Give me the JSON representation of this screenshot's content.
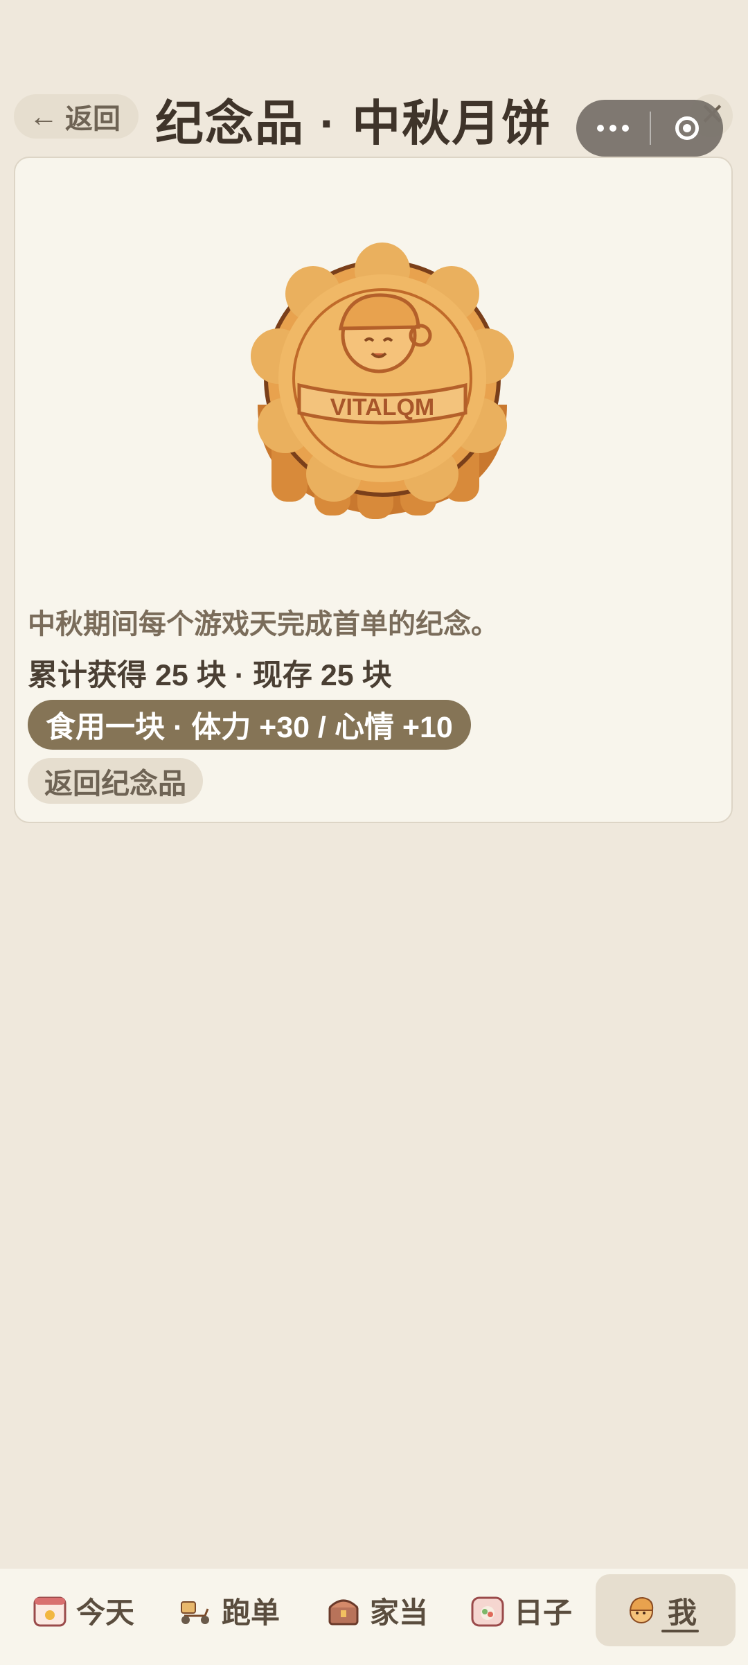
{
  "header": {
    "back_label": "返回",
    "title": "纪念品 · 中秋月饼"
  },
  "card": {
    "emblem_text": "VITALQM",
    "description": "中秋期间每个游戏天完成首单的纪念。",
    "count_text": "累计获得 25 块 · 现存 25 块",
    "eat_button_label": "食用一块 · 体力 +30 / 心情 +10",
    "back_button_label": "返回纪念品"
  },
  "tabbar": {
    "tabs": [
      {
        "label": "今天",
        "icon": "calendar-sun-icon"
      },
      {
        "label": "跑单",
        "icon": "scooter-icon"
      },
      {
        "label": "家当",
        "icon": "treasure-chest-icon"
      },
      {
        "label": "日子",
        "icon": "calendar-food-icon"
      },
      {
        "label": "我",
        "icon": "courier-avatar-icon"
      }
    ],
    "active_index": 4
  },
  "colors": {
    "background": "#efe8dc",
    "card": "#f8f5ec",
    "primary_button": "#857456",
    "pill": "#e6decf",
    "mooncake": "#e8a24e"
  }
}
